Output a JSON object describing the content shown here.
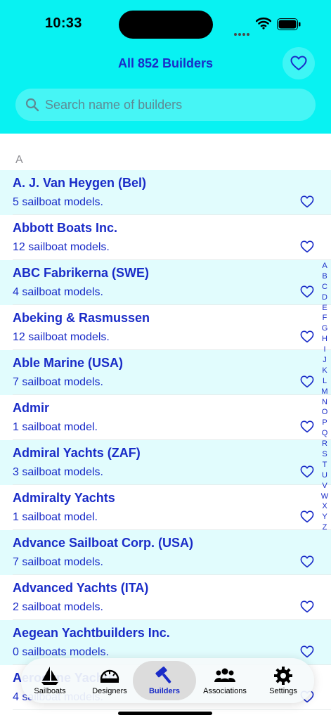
{
  "status_bar": {
    "time": "10:33"
  },
  "header": {
    "title": "All 852 Builders",
    "favorites_icon": "heart-outline-icon"
  },
  "search": {
    "placeholder": "Search name of builders",
    "value": ""
  },
  "section": {
    "letter": "A"
  },
  "builders": [
    {
      "name": "A. J. Van Heygen (Bel)",
      "count": "5 sailboat models."
    },
    {
      "name": "Abbott Boats Inc.",
      "count": "12 sailboat models."
    },
    {
      "name": "ABC Fabrikerna (SWE)",
      "count": "4 sailboat models."
    },
    {
      "name": "Abeking & Rasmussen",
      "count": "12 sailboat models."
    },
    {
      "name": "Able Marine (USA)",
      "count": "7 sailboat models."
    },
    {
      "name": "Admir",
      "count": "1 sailboat model."
    },
    {
      "name": "Admiral Yachts (ZAF)",
      "count": "3 sailboat models."
    },
    {
      "name": "Admiralty Yachts",
      "count": "1 sailboat model."
    },
    {
      "name": "Advance Sailboat Corp. (USA)",
      "count": "7 sailboat models."
    },
    {
      "name": "Advanced Yachts (ITA)",
      "count": "2 sailboat models."
    },
    {
      "name": "Aegean Yachtbuilders Inc.",
      "count": "0 sailboats models."
    },
    {
      "name": "Aerodyne Yachts",
      "count": "4 sailboat models."
    }
  ],
  "index_letters": [
    "A",
    "B",
    "C",
    "D",
    "E",
    "F",
    "G",
    "H",
    "I",
    "J",
    "K",
    "L",
    "M",
    "N",
    "O",
    "P",
    "Q",
    "R",
    "S",
    "T",
    "U",
    "V",
    "W",
    "X",
    "Y",
    "Z"
  ],
  "tabs": [
    {
      "label": "Sailboats",
      "icon": "sailboat-icon",
      "active": false
    },
    {
      "label": "Designers",
      "icon": "drafting-tool-icon",
      "active": false
    },
    {
      "label": "Builders",
      "icon": "hammer-icon",
      "active": true
    },
    {
      "label": "Associations",
      "icon": "people-group-icon",
      "active": false
    },
    {
      "label": "Settings",
      "icon": "gear-icon",
      "active": false
    }
  ],
  "colors": {
    "accent": "#1a2cc8",
    "header_background": "#08f2f2",
    "row_tint": "#e1fcfd",
    "section_header": "#8e8e93"
  }
}
